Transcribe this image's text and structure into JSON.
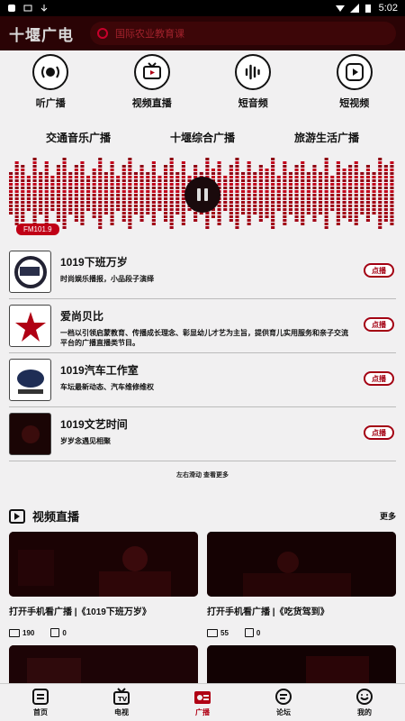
{
  "status_bar": {
    "time": "5:02"
  },
  "header": {
    "title": "十堰广电",
    "search_placeholder": "国际农业教育课"
  },
  "categories": [
    {
      "label": "听广播",
      "icon": "radio-icon"
    },
    {
      "label": "视频直播",
      "icon": "tv-icon"
    },
    {
      "label": "短音频",
      "icon": "audio-wave-icon"
    },
    {
      "label": "短视频",
      "icon": "play-icon"
    }
  ],
  "stations": [
    "交通音乐广播",
    "十堰综合广播",
    "旅游生活广播"
  ],
  "visualizer": {
    "frequency_badge": "FM101.9",
    "bars": [
      0.55,
      0.85,
      0.7,
      0.45,
      0.9,
      0.6,
      0.8,
      0.5,
      0.75,
      0.95,
      0.55,
      0.7,
      0.85,
      0.5,
      0.65,
      0.9,
      0.6,
      0.8,
      0.45,
      0.7,
      0.95,
      0.55,
      0.75,
      0.6,
      0.85,
      0.5,
      0.7,
      0.9,
      0.6,
      0.8,
      0.45,
      0.75,
      0.55,
      0.9,
      0.65,
      0.8,
      0.5,
      0.7,
      0.95,
      0.6,
      0.85,
      0.55,
      0.75,
      0.65,
      0.9,
      0.5,
      0.8,
      0.6,
      0.7,
      0.85,
      0.55,
      0.75,
      0.6,
      0.9,
      0.5,
      0.8,
      0.65,
      0.7,
      0.85,
      0.55,
      0.75,
      0.6,
      0.9,
      0.7,
      0.8
    ]
  },
  "programs": [
    {
      "title": "1019下班万岁",
      "desc": "时尚娱乐播报，小品段子演绎",
      "button": "点播"
    },
    {
      "title": "爱尚贝比",
      "desc": "一档以引领启蒙教育、传播成长理念、彰显幼儿才艺为主旨，提供育儿实用服务和亲子交流平台的广播直播类节目。",
      "button": "点播"
    },
    {
      "title": "1019汽车工作室",
      "desc": "车坛最新动态、汽车维修维权",
      "button": "点播"
    },
    {
      "title": "1019文艺时间",
      "desc": "岁岁念遇见相聚",
      "button": "点播"
    }
  ],
  "swipe_hint": "左右滑动 查看更多",
  "video_section": {
    "title": "视频直播",
    "more": "更多",
    "cards": [
      {
        "title": "打开手机看广播 |《1019下班万岁》",
        "views": "190",
        "comments": "0"
      },
      {
        "title": "打开手机看广播 |《吃货驾到》",
        "views": "55",
        "comments": "0"
      }
    ]
  },
  "bottom_nav": [
    {
      "label": "首页",
      "icon": "home-icon"
    },
    {
      "label": "电视",
      "icon": "tv-icon"
    },
    {
      "label": "广播",
      "icon": "radio-icon",
      "active": true
    },
    {
      "label": "论坛",
      "icon": "forum-icon"
    },
    {
      "label": "我的",
      "icon": "profile-icon"
    }
  ],
  "colors": {
    "accent": "#b00014",
    "header_bg": "#2a0305",
    "page_bg": "#f1f0f1"
  }
}
